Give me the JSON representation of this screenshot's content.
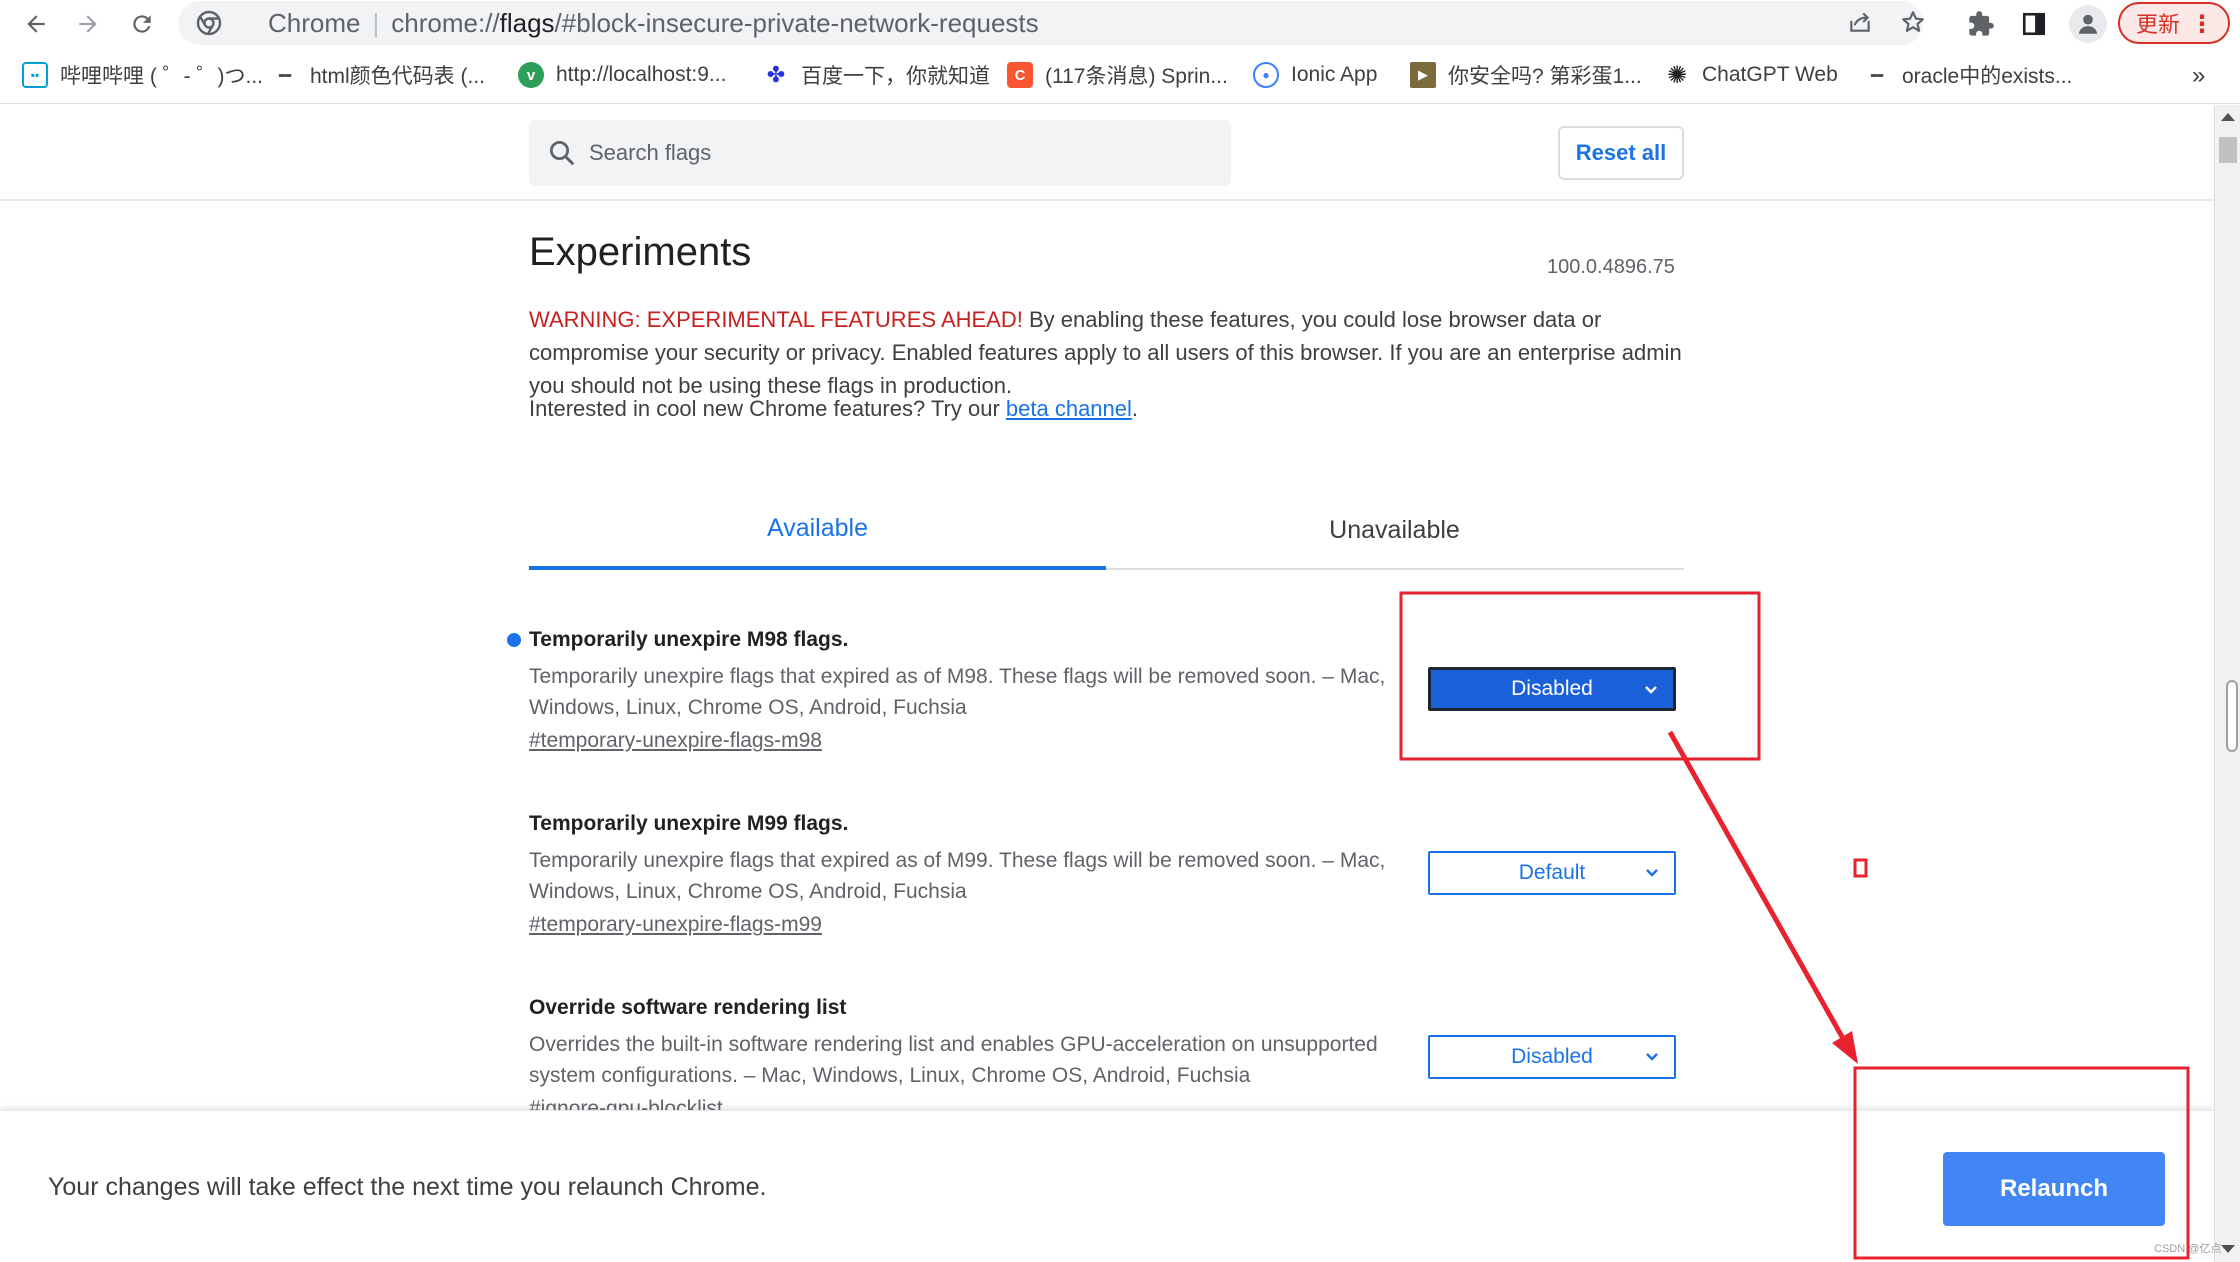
{
  "browser": {
    "brand": "Chrome",
    "url_prefix": "chrome://",
    "url_host": "flags",
    "url_rest": "/#block-insecure-private-network-requests",
    "update_label": "更新"
  },
  "bookmarks": [
    {
      "label": "哔哩哔哩 ( ゜- ゜)つ...",
      "icon": "bilibili-icon",
      "color": "#00a1d6"
    },
    {
      "label": "html颜色代码表 (...",
      "icon": "yuque-icon",
      "color": "#444444"
    },
    {
      "label": "http://localhost:9...",
      "icon": "vue-icon",
      "color": "#2e9e5b"
    },
    {
      "label": "百度一下，你就知道",
      "icon": "baidu-icon",
      "color": "#2932e1"
    },
    {
      "label": "(117条消息) Sprin...",
      "icon": "csdn-icon",
      "color": "#fc5531"
    },
    {
      "label": "Ionic App",
      "icon": "ionic-icon",
      "color": "#3880ff"
    },
    {
      "label": "你安全吗? 第彩蛋1...",
      "icon": "video-icon",
      "color": "#7b6a3a"
    },
    {
      "label": "ChatGPT Web",
      "icon": "chatgpt-icon",
      "color": "#202124"
    },
    {
      "label": "oracle中的exists...",
      "icon": "yuque-icon",
      "color": "#444444"
    }
  ],
  "bookmarks_more": "»",
  "search": {
    "placeholder": "Search flags"
  },
  "reset_label": "Reset all",
  "header": {
    "title": "Experiments",
    "version": "100.0.4896.75",
    "warning_prefix": "WARNING: EXPERIMENTAL FEATURES AHEAD!",
    "warning_text": " By enabling these features, you could lose browser data or compromise your security or privacy. Enabled features apply to all users of this browser. If you are an enterprise admin you should not be using these flags in production.",
    "promo_text": "Interested in cool new Chrome features? Try our ",
    "promo_link": "beta channel",
    "promo_end": "."
  },
  "tabs": {
    "available": "Available",
    "unavailable": "Unavailable"
  },
  "flags": [
    {
      "title": "Temporarily unexpire M98 flags.",
      "desc": "Temporarily unexpire flags that expired as of M98. These flags will be removed soon. – Mac, Windows, Linux, Chrome OS, Android, Fuchsia",
      "link": "#temporary-unexpire-flags-m98",
      "value": "Disabled"
    },
    {
      "title": "Temporarily unexpire M99 flags.",
      "desc": "Temporarily unexpire flags that expired as of M99. These flags will be removed soon. – Mac, Windows, Linux, Chrome OS, Android, Fuchsia",
      "link": "#temporary-unexpire-flags-m99",
      "value": "Default"
    },
    {
      "title": "Override software rendering list",
      "desc": "Overrides the built-in software rendering list and enables GPU-acceleration on unsupported system configurations. – Mac, Windows, Linux, Chrome OS, Android, Fuchsia",
      "link": "#ignore-gpu-blocklist",
      "value": "Disabled"
    }
  ],
  "relaunch": {
    "message": "Your changes will take effect the next time you relaunch Chrome.",
    "button": "Relaunch"
  },
  "watermark": "CSDN @亿点",
  "colors": {
    "accent": "#1a73e8",
    "warning": "#c5221f",
    "annotation": "#e8232f",
    "relaunch": "#4285f4"
  }
}
